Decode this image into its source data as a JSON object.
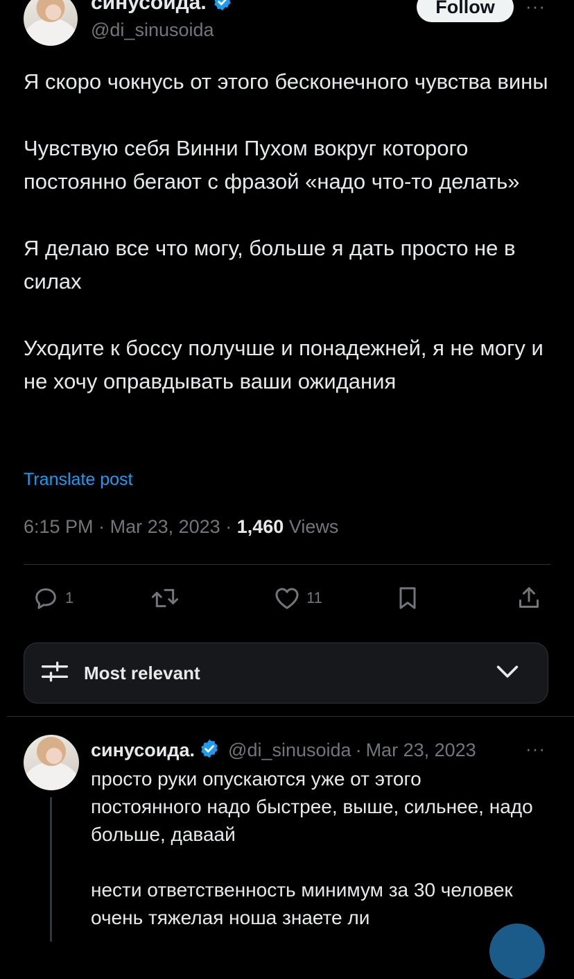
{
  "tweet": {
    "author_name": "синусоида.",
    "author_handle": "@di_sinusoida",
    "follow_label": "Follow",
    "more_label": "···",
    "paragraphs": [
      "Я скоро чокнусь от этого бесконечного чувства вины",
      "Чувствую себя Винни Пухом вокруг которого постоянно бегают с фразой «надо что-то делать»",
      "Я делаю все что могу, больше я дать просто не в силах",
      "Уходите к боссу получше и понадежней, я не могу и не хочу оправдывать ваши ожидания"
    ],
    "translate_label": "Translate post",
    "time": "6:15 PM",
    "date": "Mar 23, 2023",
    "separator": "·",
    "views_count": "1,460",
    "views_label": "Views",
    "actions": {
      "reply_count": "1",
      "retweet_count": "",
      "like_count": "11"
    },
    "verified_color": "#1d9bf0"
  },
  "sort": {
    "label": "Most relevant"
  },
  "reply": {
    "author_name": "синусоида.",
    "author_handle": "@di_sinusoida",
    "separator": "·",
    "date": "Mar 23, 2023",
    "more_label": "···",
    "paragraphs": [
      "просто руки опускаются уже от этого постоянного надо быстрее, выше, сильнее, надо больше, даваай",
      "нести ответственность минимум за 30 человек очень тяжелая ноша знаете ли"
    ]
  },
  "colors": {
    "background": "#000000",
    "text": "#e7e9ea",
    "muted": "#71767b",
    "accent": "#1d9bf0",
    "divider": "#2f3336"
  }
}
